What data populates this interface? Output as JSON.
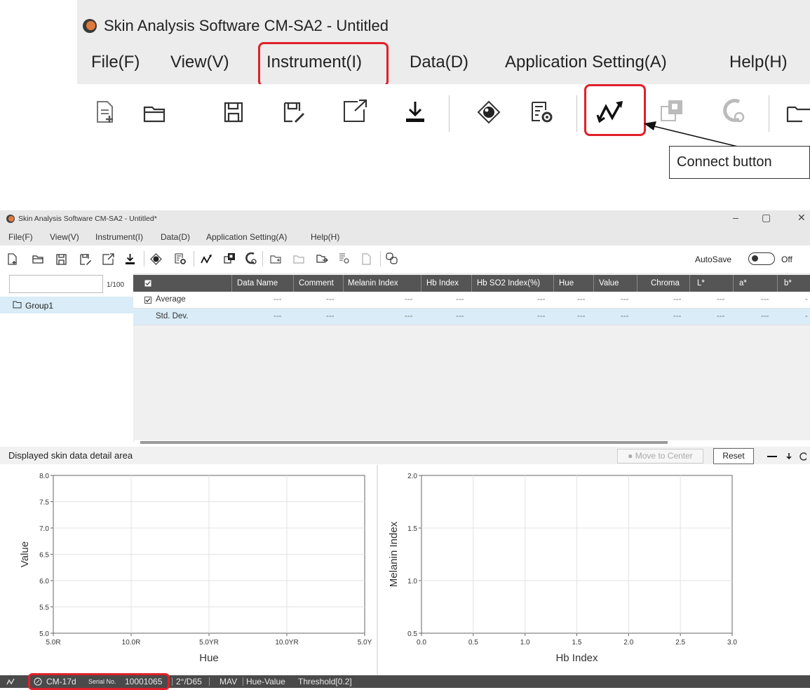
{
  "zoom": {
    "title": "Skin Analysis Software CM-SA2 - Untitled",
    "menu": [
      "File(F)",
      "View(V)",
      "Instrument(I)",
      "Data(D)",
      "Application Setting(A)",
      "Help(H)"
    ],
    "callout_label": "Connect button"
  },
  "window": {
    "title": "Skin Analysis Software CM-SA2 - Untitled*",
    "controls": {
      "minimize": "–",
      "restore": "▢",
      "close": "✕"
    },
    "menu": [
      "File(F)",
      "View(V)",
      "Instrument(I)",
      "Data(D)",
      "Application Setting(A)",
      "Help(H)"
    ],
    "autosave_label": "AutoSave",
    "autosave_state": "Off",
    "search": {
      "value": "",
      "count": "1/100"
    },
    "group": "Group1",
    "table": {
      "headers": [
        "Data Name",
        "Comment",
        "Melanin Index",
        "Hb Index",
        "Hb SO2 Index(%)",
        "Hue",
        "Value",
        "Chroma",
        "L*",
        "a*",
        "b*"
      ],
      "rows": [
        {
          "label": "Average",
          "values": [
            "---",
            "---",
            "---",
            "---",
            "---",
            "---",
            "---",
            "---",
            "---",
            "---",
            "-"
          ]
        },
        {
          "label": "Std. Dev.",
          "values": [
            "---",
            "---",
            "---",
            "---",
            "---",
            "---",
            "---",
            "---",
            "---",
            "---",
            "-"
          ]
        }
      ]
    },
    "detail": {
      "label": "Displayed skin data detail area",
      "move_to_center": "Move to Center",
      "reset": "Reset"
    },
    "status": {
      "model": "CM-17d",
      "serial_label": "Serial No.",
      "serial": "10001065",
      "observer": "2°/D65",
      "mode": "MAV",
      "plot": "Hue-Value",
      "threshold": "Threshold[0.2]"
    }
  },
  "chart_data": [
    {
      "type": "scatter",
      "title": "",
      "xlabel": "Hue",
      "ylabel": "Value",
      "x_ticks": [
        "5.0R",
        "10.0R",
        "5.0YR",
        "10.0YR",
        "5.0Y"
      ],
      "y_ticks": [
        "5.0",
        "5.5",
        "6.0",
        "6.5",
        "7.0",
        "7.5",
        "8.0"
      ],
      "ylim": [
        5.0,
        8.0
      ],
      "grid": true,
      "series": []
    },
    {
      "type": "scatter",
      "title": "",
      "xlabel": "Hb Index",
      "ylabel": "Melanin Index",
      "x_ticks": [
        "0.0",
        "0.5",
        "1.0",
        "1.5",
        "2.0",
        "2.5",
        "3.0"
      ],
      "y_ticks": [
        "0.5",
        "1.0",
        "1.5",
        "2.0"
      ],
      "xlim": [
        0.0,
        3.0
      ],
      "ylim": [
        0.5,
        2.0
      ],
      "grid": true,
      "series": []
    }
  ]
}
